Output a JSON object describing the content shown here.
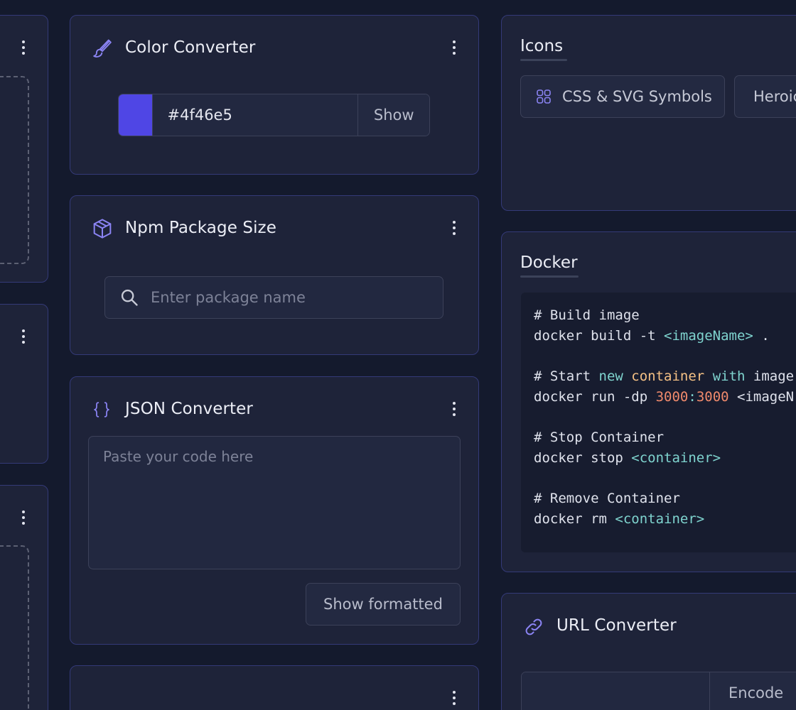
{
  "colors": {
    "accent": "#4f46e5",
    "icon": "#8b84f4",
    "card_bg": "#1e2339",
    "page_bg": "#141a2d",
    "border": "#343a78"
  },
  "color_converter": {
    "title": "Color Converter",
    "icon": "brush-icon",
    "value": "#4f46e5",
    "show_label": "Show"
  },
  "npm": {
    "title": "Npm Package Size",
    "icon": "cube-icon",
    "placeholder": "Enter package name"
  },
  "json": {
    "title": "JSON Converter",
    "icon": "braces-icon",
    "placeholder": "Paste your code here",
    "button_label": "Show formatted"
  },
  "icons": {
    "title": "Icons",
    "chips": [
      {
        "label": "CSS & SVG Symbols",
        "icon": "grid-icon"
      },
      {
        "label": "Heroic"
      }
    ]
  },
  "docker": {
    "title": "Docker",
    "code": {
      "c1": "# Build image",
      "l2a": "docker build -t ",
      "l2b": "<imageName>",
      "l2c": " .",
      "c4a": "# Start ",
      "c4b": "new",
      "c4c": " ",
      "c4d": "container",
      "c4e": " ",
      "c4f": "with",
      "c4g": " image",
      "l5a": "docker run -dp ",
      "l5b": "3000",
      "l5c": ":",
      "l5d": "3000",
      "l5e": " <imageN",
      "c7": "# Stop Container",
      "l8a": "docker stop ",
      "l8b": "<container>",
      "c10": "# Remove Container",
      "l11a": "docker rm ",
      "l11b": "<container>"
    }
  },
  "url_converter": {
    "title": "URL Converter",
    "icon": "link-icon",
    "encode_label": "Encode"
  }
}
